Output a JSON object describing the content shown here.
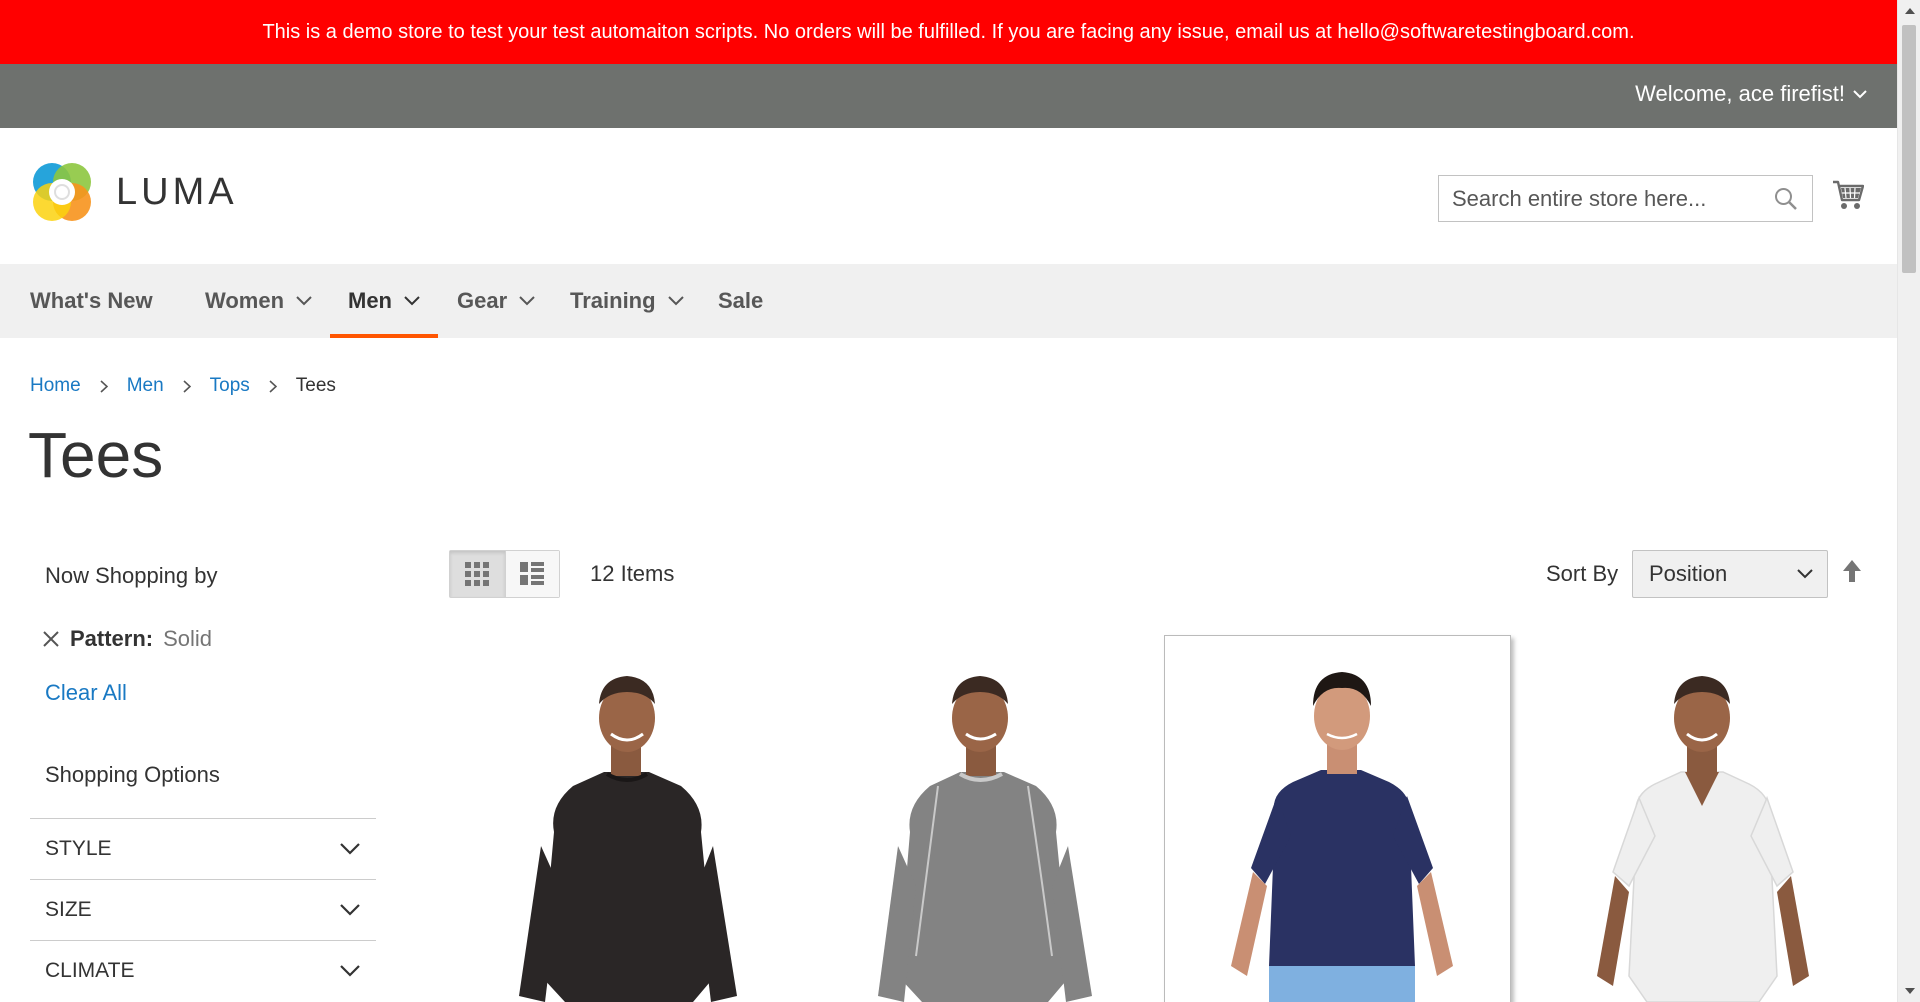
{
  "banner": {
    "text": "This is a demo store to test your test automaiton scripts. No orders will be fulfilled. If you are facing any issue, email us at hello@softwaretestingboard.com."
  },
  "account": {
    "welcome": "Welcome, ace firefist!"
  },
  "logo": {
    "text": "LUMA"
  },
  "search": {
    "placeholder": "Search entire store here..."
  },
  "nav": {
    "items": [
      {
        "label": "What's New",
        "has_dropdown": false
      },
      {
        "label": "Women",
        "has_dropdown": true
      },
      {
        "label": "Men",
        "has_dropdown": true,
        "active": true
      },
      {
        "label": "Gear",
        "has_dropdown": true
      },
      {
        "label": "Training",
        "has_dropdown": true
      },
      {
        "label": "Sale",
        "has_dropdown": false
      }
    ]
  },
  "breadcrumb": {
    "items": [
      "Home",
      "Men",
      "Tops"
    ],
    "current": "Tees"
  },
  "page": {
    "title": "Tees"
  },
  "sidebar": {
    "now_shopping_title": "Now Shopping by",
    "active_filter": {
      "label": "Pattern:",
      "value": "Solid"
    },
    "clear_all": "Clear All",
    "shopping_options_title": "Shopping Options",
    "filters": [
      "STYLE",
      "SIZE",
      "CLIMATE"
    ]
  },
  "toolbar": {
    "items_count": "12 Items",
    "sort_label": "Sort By",
    "sort_value": "Position"
  },
  "products": [
    {
      "shirt_color": "#2a2626",
      "style": "long-sleeve"
    },
    {
      "shirt_color": "#838383",
      "style": "long-sleeve"
    },
    {
      "shirt_color": "#2a3263",
      "style": "short-sleeve"
    },
    {
      "shirt_color": "#efefef",
      "style": "v-neck"
    }
  ],
  "colors": {
    "banner": "#ff0000",
    "welcome_bar": "#6e716e",
    "nav_bg": "#f0f0f0",
    "nav_active_underline": "#ff5501",
    "link": "#1979c3"
  }
}
